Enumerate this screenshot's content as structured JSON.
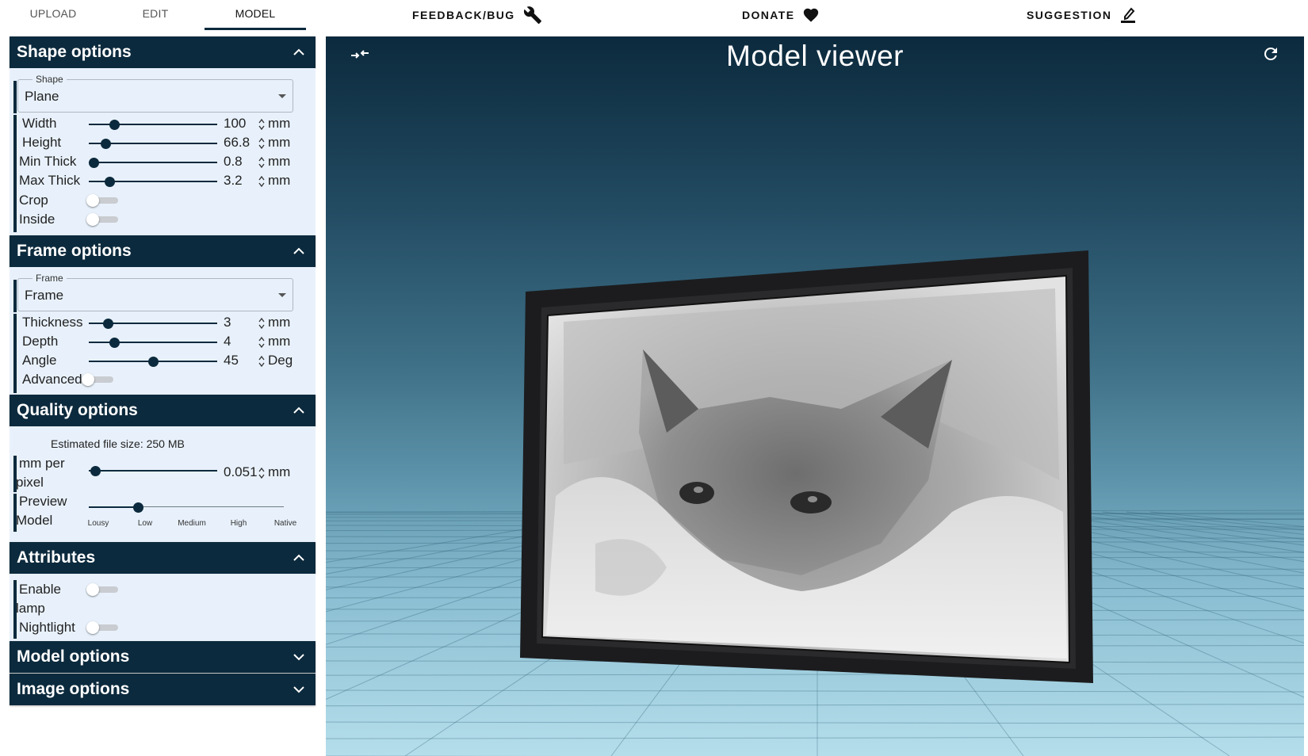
{
  "nav": {
    "tabs": [
      {
        "label": "UPLOAD",
        "active": false
      },
      {
        "label": "EDIT",
        "active": false
      },
      {
        "label": "MODEL",
        "active": true
      }
    ],
    "links": [
      {
        "label": "FEEDBACK/BUG",
        "icon": "wrench-icon"
      },
      {
        "label": "DONATE",
        "icon": "heart-icon"
      },
      {
        "label": "SUGGESTION",
        "icon": "edit-note-icon"
      }
    ]
  },
  "sidebar": {
    "shape": {
      "title": "Shape options",
      "expanded": true,
      "select": {
        "legend": "Shape",
        "value": "Plane"
      },
      "sliders": [
        {
          "label": "Width",
          "value": "100",
          "unit": "mm",
          "level": 0.2
        },
        {
          "label": "Height",
          "value": "66.8",
          "unit": "mm",
          "level": 0.13
        },
        {
          "label": "Min Thick",
          "value": "0.8",
          "unit": "mm",
          "level": 0.04
        },
        {
          "label": "Max Thick",
          "value": "3.2",
          "unit": "mm",
          "level": 0.16
        }
      ],
      "toggles": [
        {
          "label": "Crop",
          "on": false
        },
        {
          "label": "Inside",
          "on": false
        }
      ]
    },
    "frame": {
      "title": "Frame options",
      "expanded": true,
      "select": {
        "legend": "Frame",
        "value": "Frame"
      },
      "sliders": [
        {
          "label": "Thickness",
          "value": "3",
          "unit": "mm",
          "level": 0.15
        },
        {
          "label": "Depth",
          "value": "4",
          "unit": "mm",
          "level": 0.2
        },
        {
          "label": "Angle",
          "value": "45",
          "unit": "Deg",
          "level": 0.5
        }
      ],
      "toggles": [
        {
          "label": "Advanced",
          "on": false
        }
      ]
    },
    "quality": {
      "title": "Quality options",
      "expanded": true,
      "file_size": "Estimated file size: 250 MB",
      "mm_per_pixel": {
        "label_line1": "mm per",
        "label_line2": "pixel",
        "value": "0.051",
        "unit": "mm",
        "level": 0.05
      },
      "preview": {
        "label_line1": "Preview",
        "label_line2": "Model",
        "ticks": [
          "Lousy",
          "Low",
          "Medium",
          "High",
          "Native"
        ],
        "selected_index": 1
      }
    },
    "attributes": {
      "title": "Attributes",
      "expanded": true,
      "toggles": [
        {
          "label_line1": "Enable",
          "label_line2": "lamp",
          "on": false
        },
        {
          "label_line1": "Nightlight",
          "label_line2": "",
          "on": false
        }
      ]
    },
    "model": {
      "title": "Model options",
      "expanded": false
    },
    "image": {
      "title": "Image options",
      "expanded": false
    }
  },
  "viewer": {
    "title": "Model viewer",
    "collapse_icon": "collapse-arrows-icon",
    "refresh_icon": "refresh-icon"
  },
  "colors": {
    "primary": "#0c2a3d",
    "panel": "#e8f1fb"
  }
}
